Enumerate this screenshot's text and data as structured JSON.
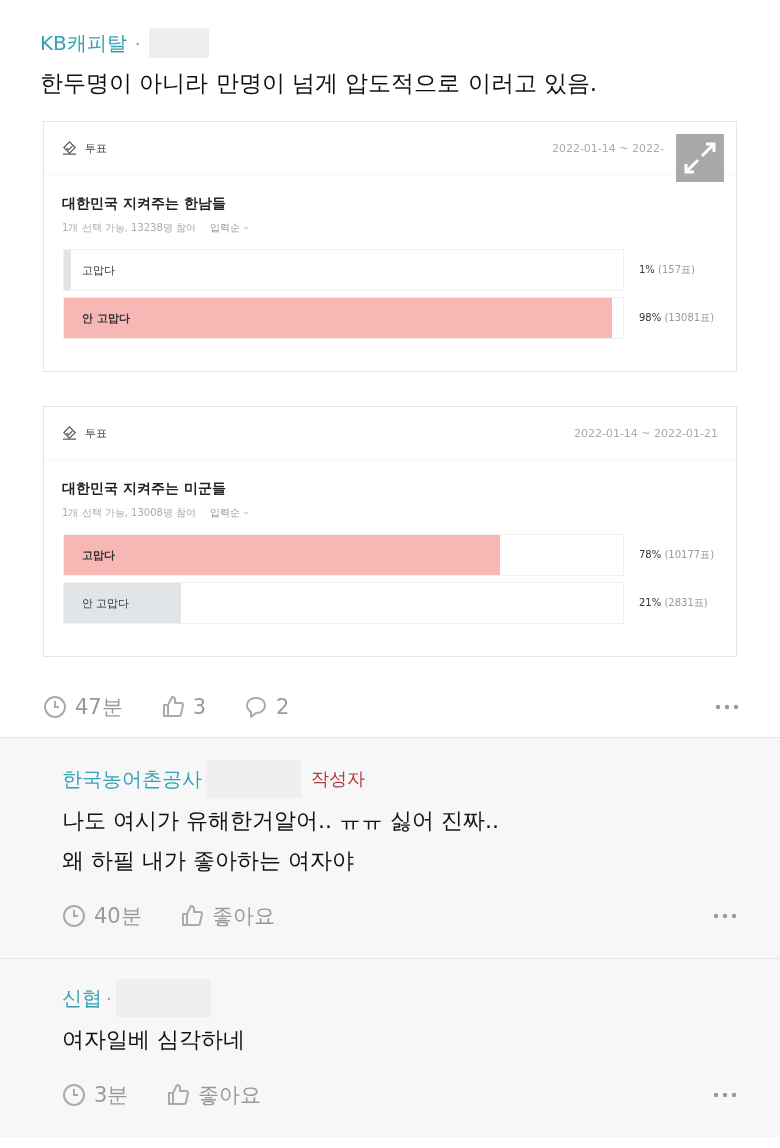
{
  "post": {
    "author": "KB캐피탈",
    "separator": "·",
    "text": "한두명이 아니라 만명이 넘게 압도적으로 이러고 있음.",
    "polls": [
      {
        "label": "투표",
        "dates": "2022-01-14 ~ 2022-",
        "expand_overlay": true,
        "question": "대한민국 지켜주는 한남들",
        "info": "1개 선택 가능, 13238명 참여",
        "sort": "입력순",
        "options": [
          {
            "label": "고맙다",
            "level": 0.01,
            "leading": false,
            "percent": "1%",
            "votes": "(157표)"
          },
          {
            "label": "안 고맙다",
            "level": 0.98,
            "leading": true,
            "percent": "98%",
            "votes": "(13081표)"
          }
        ]
      },
      {
        "label": "투표",
        "dates": "2022-01-14 ~ 2022-01-21",
        "expand_overlay": false,
        "question": "대한민국 지켜주는 미군들",
        "info": "1개 선택 가능, 13008명 참여",
        "sort": "입력순",
        "options": [
          {
            "label": "고맙다",
            "level": 0.78,
            "leading": true,
            "percent": "78%",
            "votes": "(10177표)"
          },
          {
            "label": "안 고맙다",
            "level": 0.21,
            "leading": false,
            "percent": "21%",
            "votes": "(2831표)"
          }
        ]
      }
    ],
    "time": "47분",
    "likes": "3",
    "comments": "2"
  },
  "comments": [
    {
      "author": "한국농어촌공사",
      "is_writer": true,
      "writer_badge": "작성자",
      "lines": [
        "나도 여시가 유해한거알어.. ㅠㅠ 싫어 진짜..",
        "왜 하필 내가 좋아하는 여자야"
      ],
      "time": "40분",
      "like_label": "좋아요"
    },
    {
      "author": "신협",
      "separator": "·",
      "is_writer": false,
      "lines": [
        "여자일베 심각하네"
      ],
      "time": "3분",
      "like_label": "좋아요"
    }
  ]
}
